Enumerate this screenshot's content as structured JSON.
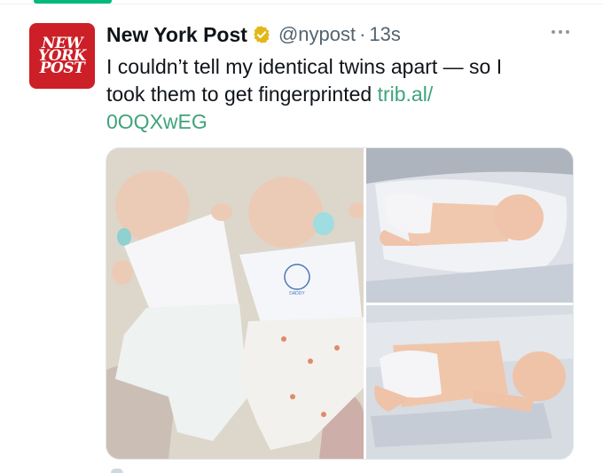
{
  "tweet": {
    "author": {
      "name": "New York Post",
      "handle": "@nypost",
      "verified_icon": "gold-verified-badge-icon",
      "avatar_logo_lines": [
        "NEW",
        "YORK",
        "POST"
      ],
      "avatar_color": "#cc1f27"
    },
    "separator": "·",
    "time": "13s",
    "more_icon": "more-options-icon",
    "text_line_1": "I couldn’t tell my identical twins apart — so I",
    "text_line_2": "took them to get fingerprinted ",
    "link_part_1": "trib.al/",
    "link_part_2": "0OQXwEG",
    "link_color": "#3fa37c"
  },
  "media": {
    "photos": [
      {
        "label": "twin-babies-lying-side-by-side-with-pacifiers"
      },
      {
        "label": "newborn-sleeping-in-lounger"
      },
      {
        "label": "newborn-sleeping-on-blanket"
      }
    ],
    "onesie_print": "DADDY"
  },
  "colors": {
    "accent_tab": "#00ba7c",
    "secondary_text": "#536471"
  }
}
